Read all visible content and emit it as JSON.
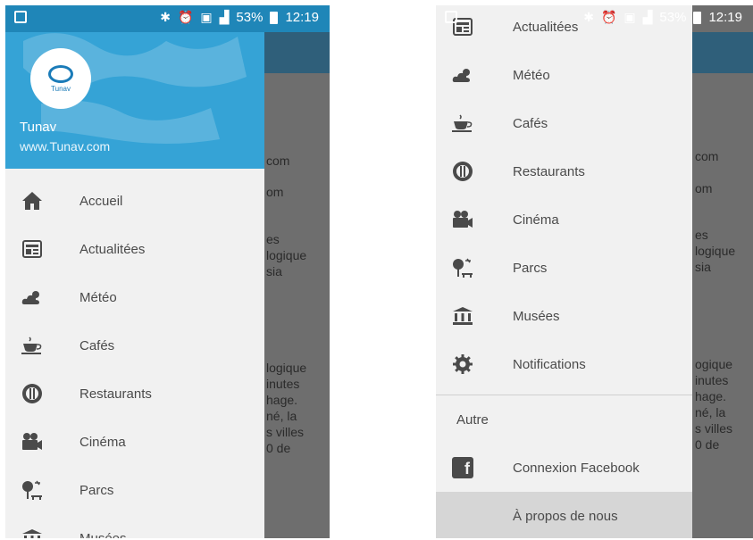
{
  "status_bar": {
    "battery_percent": "53%",
    "time": "12:19",
    "icons": [
      "screenshot-icon",
      "bluetooth-icon",
      "alarm-icon",
      "network-4g-icon",
      "sim2-icon",
      "signal-icon",
      "battery-icon"
    ]
  },
  "drawer_header": {
    "logo_text": "Tunav",
    "name": "Tunav",
    "website": "www.Tunav.com"
  },
  "left_menu": {
    "items": [
      {
        "label": "Accueil",
        "icon": "home-icon"
      },
      {
        "label": "Actualitées",
        "icon": "news-icon"
      },
      {
        "label": "Météo",
        "icon": "weather-icon"
      },
      {
        "label": "Cafés",
        "icon": "coffee-icon"
      },
      {
        "label": "Restaurants",
        "icon": "restaurant-icon"
      },
      {
        "label": "Cinéma",
        "icon": "cinema-icon"
      },
      {
        "label": "Parcs",
        "icon": "park-icon"
      },
      {
        "label": "Musées",
        "icon": "museum-icon"
      }
    ]
  },
  "right_menu": {
    "items": [
      {
        "label": "Actualitées",
        "icon": "news-icon"
      },
      {
        "label": "Météo",
        "icon": "weather-icon"
      },
      {
        "label": "Cafés",
        "icon": "coffee-icon"
      },
      {
        "label": "Restaurants",
        "icon": "restaurant-icon"
      },
      {
        "label": "Cinéma",
        "icon": "cinema-icon"
      },
      {
        "label": "Parcs",
        "icon": "park-icon"
      },
      {
        "label": "Musées",
        "icon": "museum-icon"
      },
      {
        "label": "Notifications",
        "icon": "gear-icon"
      }
    ],
    "section_label": "Autre",
    "facebook_label": "Connexion Facebook",
    "about_label": "À propos de nous"
  },
  "background_text": {
    "left": [
      "com",
      "om",
      "es",
      "logique",
      "sia",
      "logique",
      "inutes",
      "hage.",
      "né, la",
      "s villes",
      "0 de"
    ],
    "right": [
      "com",
      "om",
      "es",
      "logique",
      "sia",
      "ogique",
      "inutes",
      "hage.",
      "né, la",
      "s villes",
      "0 de"
    ]
  },
  "colors": {
    "header_blue": "#35a3d6",
    "status_bar_blue": "#1f86b8",
    "drawer_bg": "#f1f1f1",
    "active_item_bg": "#d6d6d6"
  }
}
